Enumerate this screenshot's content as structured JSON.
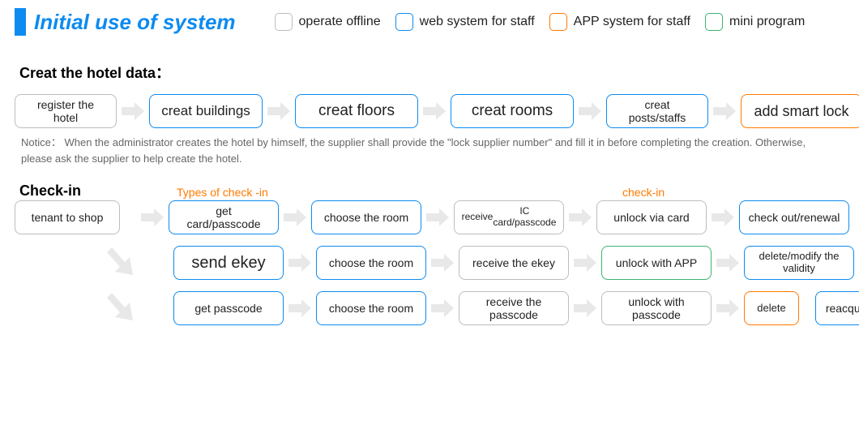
{
  "header": {
    "title": "Initial use of system",
    "legend": [
      {
        "label": "operate offline",
        "cls": "gray"
      },
      {
        "label": "web system for staff",
        "cls": "blue"
      },
      {
        "label": "APP system for staff",
        "cls": "orange"
      },
      {
        "label": "mini program",
        "cls": "green"
      }
    ]
  },
  "section1": {
    "title": "Creat the hotel data：",
    "steps": [
      {
        "label": "register the hotel",
        "cls": "gray",
        "size": "sz-a"
      },
      {
        "label": "creat buildings",
        "cls": "blue",
        "size": "sz-b"
      },
      {
        "label": "creat floors",
        "cls": "blue",
        "size": "sz-c"
      },
      {
        "label": "creat rooms",
        "cls": "blue",
        "size": "sz-c"
      },
      {
        "label": "creat posts/staffs",
        "cls": "blue",
        "size": "sz-a"
      },
      {
        "label": "add smart lock",
        "cls": "orange",
        "size": "sz-lg"
      }
    ],
    "notice": "Notice： When the administrator creates the hotel by himself, the supplier shall provide the \"lock supplier number\" and fill it in before completing the creation. Otherwise, please ask the supplier to help create the hotel."
  },
  "section2": {
    "title": "Check-in",
    "annot1": "Types of check -in",
    "annot2": "check-in",
    "tenant": "tenant to shop",
    "rows": [
      {
        "branch": false,
        "steps": [
          {
            "label": "get card/passcode",
            "cls": "blue",
            "size": "sz-m"
          },
          {
            "label": "choose the room",
            "cls": "blue",
            "size": "sz-m"
          },
          {
            "label": "receive\nIC card/passcode",
            "cls": "gray",
            "size": "sz-m",
            "fs": "12px"
          },
          {
            "label": "unlock via card",
            "cls": "gray",
            "size": "sz-m"
          },
          {
            "label": "check out/renewal",
            "cls": "blue",
            "size": "sz-m"
          }
        ]
      },
      {
        "branch": true,
        "steps": [
          {
            "label": "send ekey",
            "cls": "blue",
            "size": "sz-m",
            "fs": "20px"
          },
          {
            "label": "choose the room",
            "cls": "blue",
            "size": "sz-m"
          },
          {
            "label": "receive the ekey",
            "cls": "gray",
            "size": "sz-m"
          },
          {
            "label": "unlock with APP",
            "cls": "green",
            "size": "sz-m"
          },
          {
            "label": "delete/modify the validity",
            "cls": "blue",
            "size": "sz-m",
            "fs": "13px"
          }
        ]
      },
      {
        "branch": true,
        "steps": [
          {
            "label": "get passcode",
            "cls": "blue",
            "size": "sz-m"
          },
          {
            "label": "choose the room",
            "cls": "blue",
            "size": "sz-m"
          },
          {
            "label": "receive the passcode",
            "cls": "gray",
            "size": "sz-m"
          },
          {
            "label": "unlock with passcode",
            "cls": "gray",
            "size": "sz-m"
          },
          {
            "label": "delete",
            "cls": "orange",
            "size": "sz-xs"
          },
          {
            "label": "reacquire",
            "cls": "blue",
            "size": "sz-sm"
          }
        ],
        "lastNoArrow": true
      }
    ]
  }
}
